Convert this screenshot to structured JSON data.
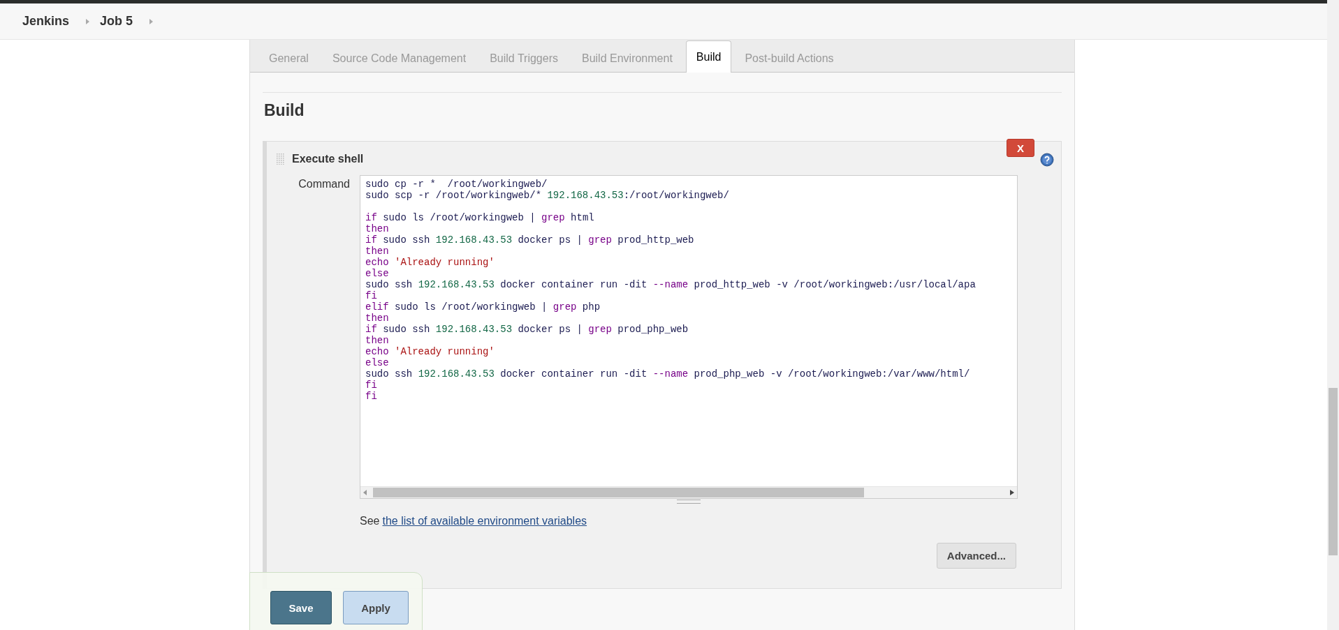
{
  "breadcrumb": [
    "Jenkins",
    "Job 5"
  ],
  "tabs": [
    {
      "label": "General",
      "selected": false
    },
    {
      "label": "Source Code Management",
      "selected": false
    },
    {
      "label": "Build Triggers",
      "selected": false
    },
    {
      "label": "Build Environment",
      "selected": false
    },
    {
      "label": "Build",
      "selected": true
    },
    {
      "label": "Post-build Actions",
      "selected": false
    }
  ],
  "section_title": "Build",
  "build_step": {
    "title": "Execute shell",
    "delete_label": "X",
    "command_label": "Command",
    "code_blocks": [
      [
        [
          {
            "kind": "plain",
            "text": "sudo cp -r *  /root/workingweb/"
          }
        ],
        [
          {
            "kind": "plain",
            "text": "sudo scp -r /root/workingweb/* "
          },
          {
            "kind": "number",
            "text": "192.168.43.53"
          },
          {
            "kind": "plain",
            "text": ":/root/workingweb/"
          }
        ]
      ],
      [
        [
          {
            "kind": "keyword",
            "text": "if"
          },
          {
            "kind": "plain",
            "text": " sudo ls /root/workingweb | "
          },
          {
            "kind": "keyword",
            "text": "grep"
          },
          {
            "kind": "plain",
            "text": " html"
          }
        ],
        [
          {
            "kind": "keyword",
            "text": "then"
          }
        ],
        [
          {
            "kind": "keyword",
            "text": "if"
          },
          {
            "kind": "plain",
            "text": " sudo ssh "
          },
          {
            "kind": "number",
            "text": "192.168.43.53"
          },
          {
            "kind": "plain",
            "text": " docker ps | "
          },
          {
            "kind": "keyword",
            "text": "grep"
          },
          {
            "kind": "plain",
            "text": " prod_http_web"
          }
        ],
        [
          {
            "kind": "keyword",
            "text": "then"
          }
        ],
        [
          {
            "kind": "keyword",
            "text": "echo"
          },
          {
            "kind": "string",
            "text": " 'Already running'"
          }
        ],
        [
          {
            "kind": "keyword",
            "text": "else"
          }
        ],
        [
          {
            "kind": "plain",
            "text": "sudo ssh "
          },
          {
            "kind": "number",
            "text": "192.168.43.53"
          },
          {
            "kind": "plain",
            "text": " docker container run -dit "
          },
          {
            "kind": "keyword",
            "text": "--name"
          },
          {
            "kind": "plain",
            "text": " prod_http_web -v /root/workingweb:/usr/local/apa"
          }
        ],
        [
          {
            "kind": "keyword",
            "text": "fi"
          }
        ],
        [
          {
            "kind": "keyword",
            "text": "elif"
          },
          {
            "kind": "plain",
            "text": " sudo ls /root/workingweb | "
          },
          {
            "kind": "keyword",
            "text": "grep"
          },
          {
            "kind": "plain",
            "text": " php"
          }
        ],
        [
          {
            "kind": "keyword",
            "text": "then"
          }
        ],
        [
          {
            "kind": "keyword",
            "text": "if"
          },
          {
            "kind": "plain",
            "text": " sudo ssh "
          },
          {
            "kind": "number",
            "text": "192.168.43.53"
          },
          {
            "kind": "plain",
            "text": " docker ps | "
          },
          {
            "kind": "keyword",
            "text": "grep"
          },
          {
            "kind": "plain",
            "text": " prod_php_web"
          }
        ],
        [
          {
            "kind": "keyword",
            "text": "then"
          }
        ],
        [
          {
            "kind": "keyword",
            "text": "echo"
          },
          {
            "kind": "string",
            "text": " 'Already running'"
          }
        ],
        [
          {
            "kind": "keyword",
            "text": "else"
          }
        ],
        [
          {
            "kind": "plain",
            "text": "sudo ssh "
          },
          {
            "kind": "number",
            "text": "192.168.43.53"
          },
          {
            "kind": "plain",
            "text": " docker container run -dit "
          },
          {
            "kind": "keyword",
            "text": "--name"
          },
          {
            "kind": "plain",
            "text": " prod_php_web -v /root/workingweb:/var/www/html/"
          }
        ],
        [
          {
            "kind": "keyword",
            "text": "fi"
          }
        ],
        [
          {
            "kind": "keyword",
            "text": "fi"
          }
        ]
      ]
    ],
    "env_hint": "See",
    "env_link": "the list of available environment variables",
    "advanced_button": "Advanced..."
  },
  "buttons": {
    "save": "Save",
    "apply": "Apply"
  }
}
